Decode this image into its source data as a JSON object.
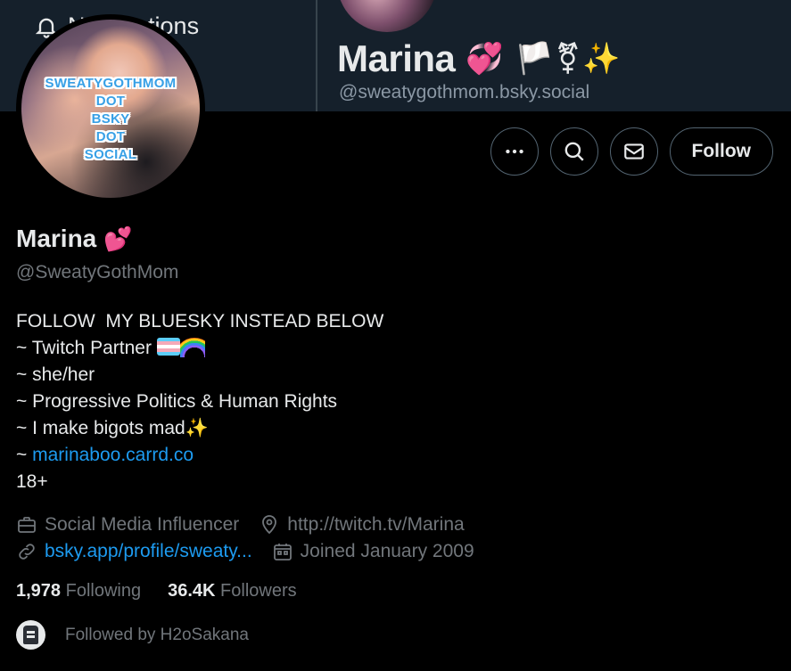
{
  "banner": {
    "notifications_label": "Notifications",
    "name": "Marina",
    "name_emojis": "💞 🏳️⚧✨",
    "handle": "@sweatygothmom.bsky.social"
  },
  "avatar": {
    "text_lines": [
      "SWEATYGOTHMOM",
      "DOT",
      "BSKY",
      "DOT",
      "SOCIAL"
    ]
  },
  "actions": {
    "more_icon": "more-dots-icon",
    "search_icon": "search-icon",
    "message_icon": "mail-icon",
    "follow_label": "Follow"
  },
  "profile": {
    "name": "Marina",
    "name_emoji": "💕",
    "handle": "@SweatyGothMom"
  },
  "bio": {
    "line1": "FOLLOW  MY BLUESKY INSTEAD BELOW",
    "line2_text": "~ Twitch Partner ",
    "line3": "~ she/her",
    "line4": "~ Progressive Politics & Human Rights",
    "line5_text": "~ I make bigots mad",
    "line5_emoji": "✨",
    "line6_prefix": "~ ",
    "line6_link": "marinaboo.carrd.co",
    "line7": "18+"
  },
  "meta": {
    "category": "Social Media Influencer",
    "location": "http://twitch.tv/Marina",
    "website": "bsky.app/profile/sweaty...",
    "joined": "Joined January 2009"
  },
  "stats": {
    "following_count": "1,978",
    "following_label": "Following",
    "followers_count": "36.4K",
    "followers_label": "Followers"
  },
  "followed_by": {
    "text": "Followed by H2oSakana"
  },
  "colors": {
    "background": "#000000",
    "banner": "#15202b",
    "link": "#1d9bf0",
    "muted": "#71767b",
    "text": "#e7e9ea"
  }
}
